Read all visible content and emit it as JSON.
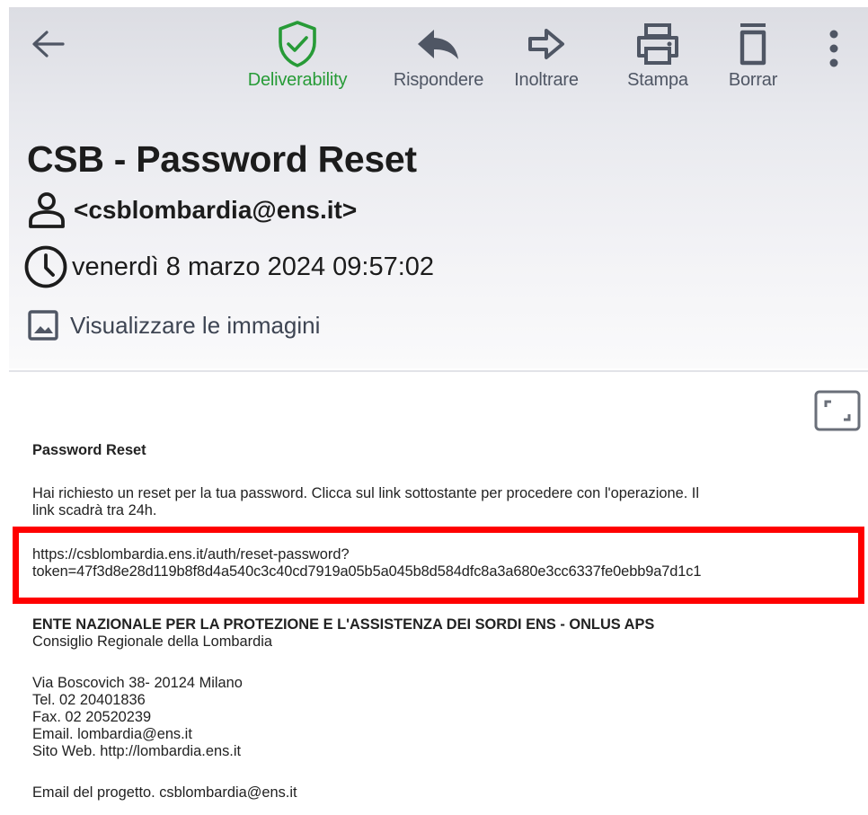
{
  "toolbar": {
    "deliverability": "Deliverability",
    "reply": "Rispondere",
    "forward": "Inoltrare",
    "print": "Stampa",
    "delete": "Borrar"
  },
  "email": {
    "subject": "CSB - Password Reset",
    "sender": "<csblombardia@ens.it>",
    "date": "venerdì 8 marzo 2024 09:57:02",
    "show_images": "Visualizzare le immagini"
  },
  "body": {
    "heading": "Password Reset",
    "intro_line1": "Hai richiesto un reset per la tua password. Clicca sul link sottostante per procedere con l'operazione. Il",
    "intro_line2": "link scadrà tra 24h.",
    "link_line1": "https://csblombardia.ens.it/auth/reset-password?",
    "link_line2": "token=47f3d8e28d119b8f8d4a540c3c40cd7919a05b5a045b8d584dfc8a3a680e3cc6337fe0ebb9a7d1c1",
    "org_name": "ENTE NAZIONALE PER LA PROTEZIONE E L'ASSISTENZA DEI SORDI ENS - ONLUS APS",
    "org_sub": "Consiglio Regionale della Lombardia",
    "address": "Via Boscovich 38- 20124 Milano",
    "tel": "Tel. 02 20401836",
    "fax": "Fax. 02 20520239",
    "email": "Email. lombardia@ens.it",
    "web": "Sito Web. http://lombardia.ens.it",
    "project_email": "Email del progetto. csblombardia@ens.it"
  },
  "colors": {
    "deliverability_green": "#279b37",
    "highlight_red": "#ff0000",
    "icon_gray": "#4f5664"
  }
}
